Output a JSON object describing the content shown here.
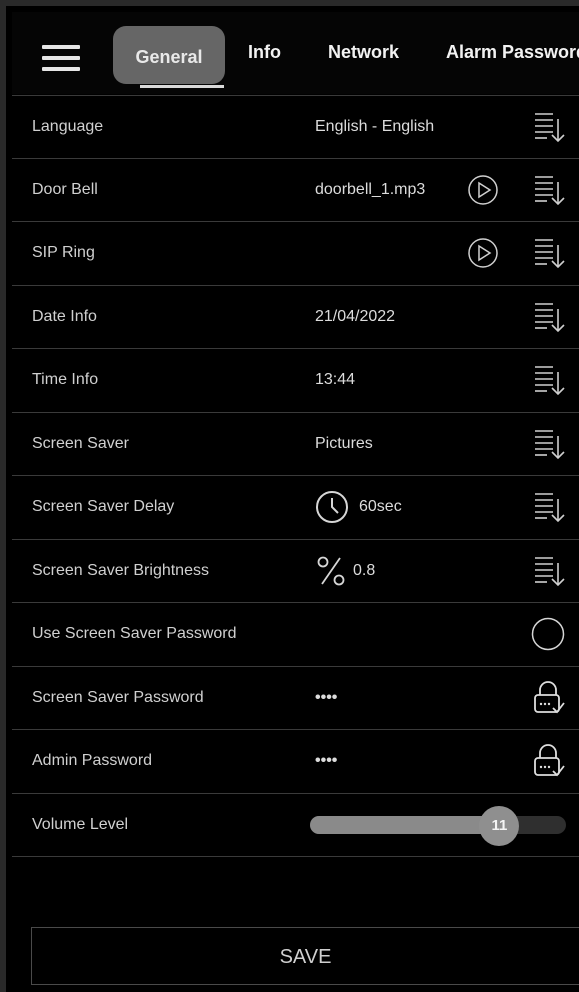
{
  "tabs": {
    "general": "General",
    "info": "Info",
    "network": "Network",
    "alarm_password": "Alarm Password"
  },
  "settings": {
    "language": {
      "label": "Language",
      "value": "English - English"
    },
    "door_bell": {
      "label": "Door Bell",
      "value": "doorbell_1.mp3"
    },
    "sip_ring": {
      "label": "SIP Ring",
      "value": ""
    },
    "date_info": {
      "label": "Date Info",
      "value": "21/04/2022"
    },
    "time_info": {
      "label": "Time Info",
      "value": "13:44"
    },
    "screen_saver": {
      "label": "Screen Saver",
      "value": "Pictures"
    },
    "screen_saver_delay": {
      "label": "Screen Saver Delay",
      "value": "60sec"
    },
    "screen_saver_brightness": {
      "label": "Screen Saver Brightness",
      "value": "0.8"
    },
    "use_screen_saver_password": {
      "label": "Use Screen Saver Password",
      "enabled": false
    },
    "screen_saver_password": {
      "label": "Screen Saver Password",
      "value": "••••"
    },
    "admin_password": {
      "label": "Admin Password",
      "value": "••••"
    },
    "volume_level": {
      "label": "Volume Level",
      "value": "11",
      "fraction": 0.74
    }
  },
  "save_label": "SAVE",
  "icons": [
    "menu-icon",
    "list-select-icon",
    "play-icon",
    "clock-icon",
    "percent-icon",
    "toggle-off-icon",
    "lock-icon"
  ],
  "colors": {
    "background": "#000000",
    "tab_active": "#666666",
    "text": "#d8d8d8",
    "slider_fill": "#8a8a8a"
  }
}
